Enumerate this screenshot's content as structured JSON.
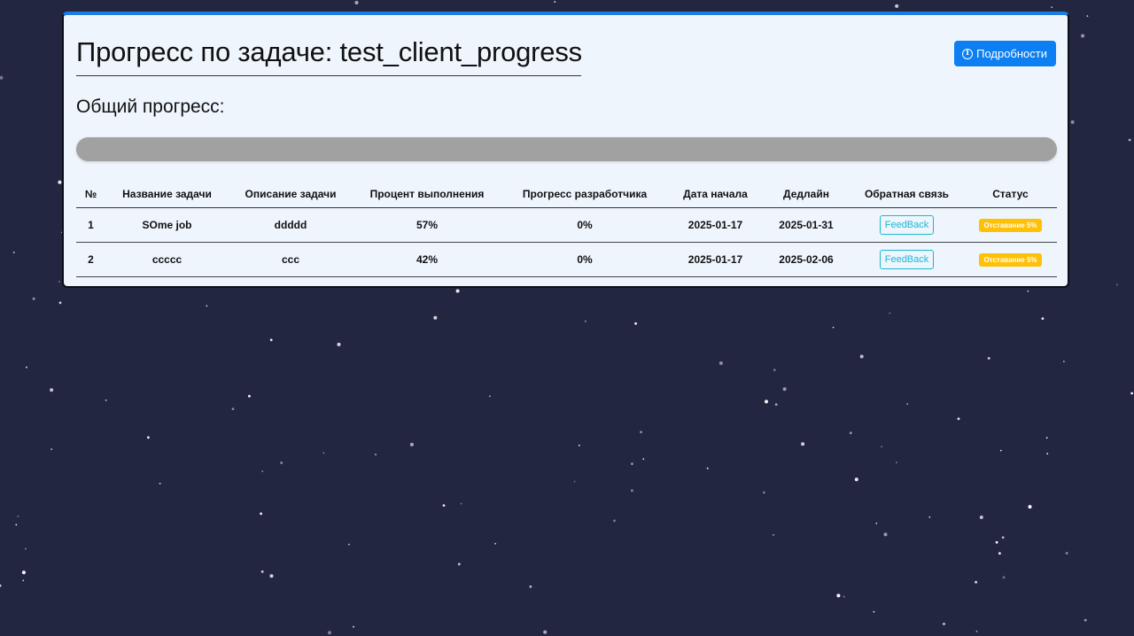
{
  "page": {
    "title": "Прогресс по задаче: test_client_progress",
    "details_button": "Подробности",
    "overall_label": "Общий прогресс:",
    "overall_progress_percent": 0
  },
  "table": {
    "headers": [
      "№",
      "Название задачи",
      "Описание задачи",
      "Процент выполнения",
      "Прогресс разработчика",
      "Дата начала",
      "Дедлайн",
      "Обратная связь",
      "Статус"
    ],
    "rows": [
      {
        "num": "1",
        "name": "SOme job",
        "description": "ddddd",
        "percent": "57%",
        "dev_progress": "0%",
        "start": "2025-01-17",
        "deadline": "2025-01-31",
        "feedback": "FeedBack",
        "status": "Отставание 5%"
      },
      {
        "num": "2",
        "name": "ccccc",
        "description": "ccc",
        "percent": "42%",
        "dev_progress": "0%",
        "start": "2025-01-17",
        "deadline": "2025-02-06",
        "feedback": "FeedBack",
        "status": "Отставание 5%"
      }
    ]
  },
  "colors": {
    "background": "#232641",
    "card": "#eef5fd",
    "accent": "#0d7ff2",
    "feedback": "#19b8d3",
    "status_warning": "#ffc107",
    "progress_track": "#a1a1a1"
  },
  "icons": {
    "details": "info-circle-icon"
  }
}
